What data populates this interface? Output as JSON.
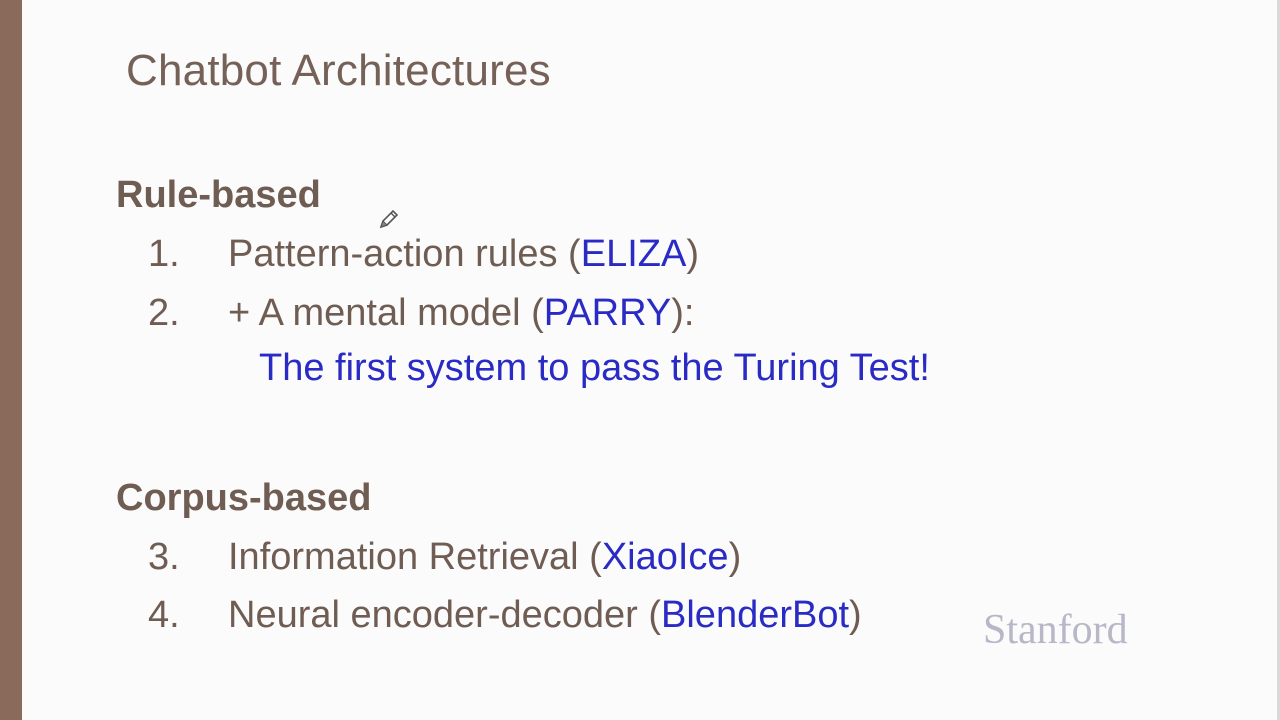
{
  "slide": {
    "title": "Chatbot Architectures",
    "sections": [
      {
        "heading": "Rule-based",
        "items": [
          {
            "num": "1.",
            "text": "Pattern-action rules (",
            "highlight": "ELIZA",
            "suffix": ")"
          },
          {
            "num": "2.",
            "text": "+ A mental model (",
            "highlight": "PARRY",
            "suffix": "):"
          }
        ],
        "note": "The first system to pass the Turing Test!"
      },
      {
        "heading": "Corpus-based",
        "items": [
          {
            "num": "3.",
            "text": "Information Retrieval (",
            "highlight": "XiaoIce",
            "suffix": ")"
          },
          {
            "num": "4.",
            "text": "Neural encoder-decoder (",
            "highlight": "BlenderBot",
            "suffix": ")"
          }
        ]
      }
    ],
    "watermark": "Stanford"
  },
  "colors": {
    "accent_bar": "#8a6a5a",
    "text": "#6f5c52",
    "highlight": "#2a2ac4",
    "watermark": "#b7b7c8"
  },
  "icons": {
    "cursor": "pencil-icon"
  }
}
